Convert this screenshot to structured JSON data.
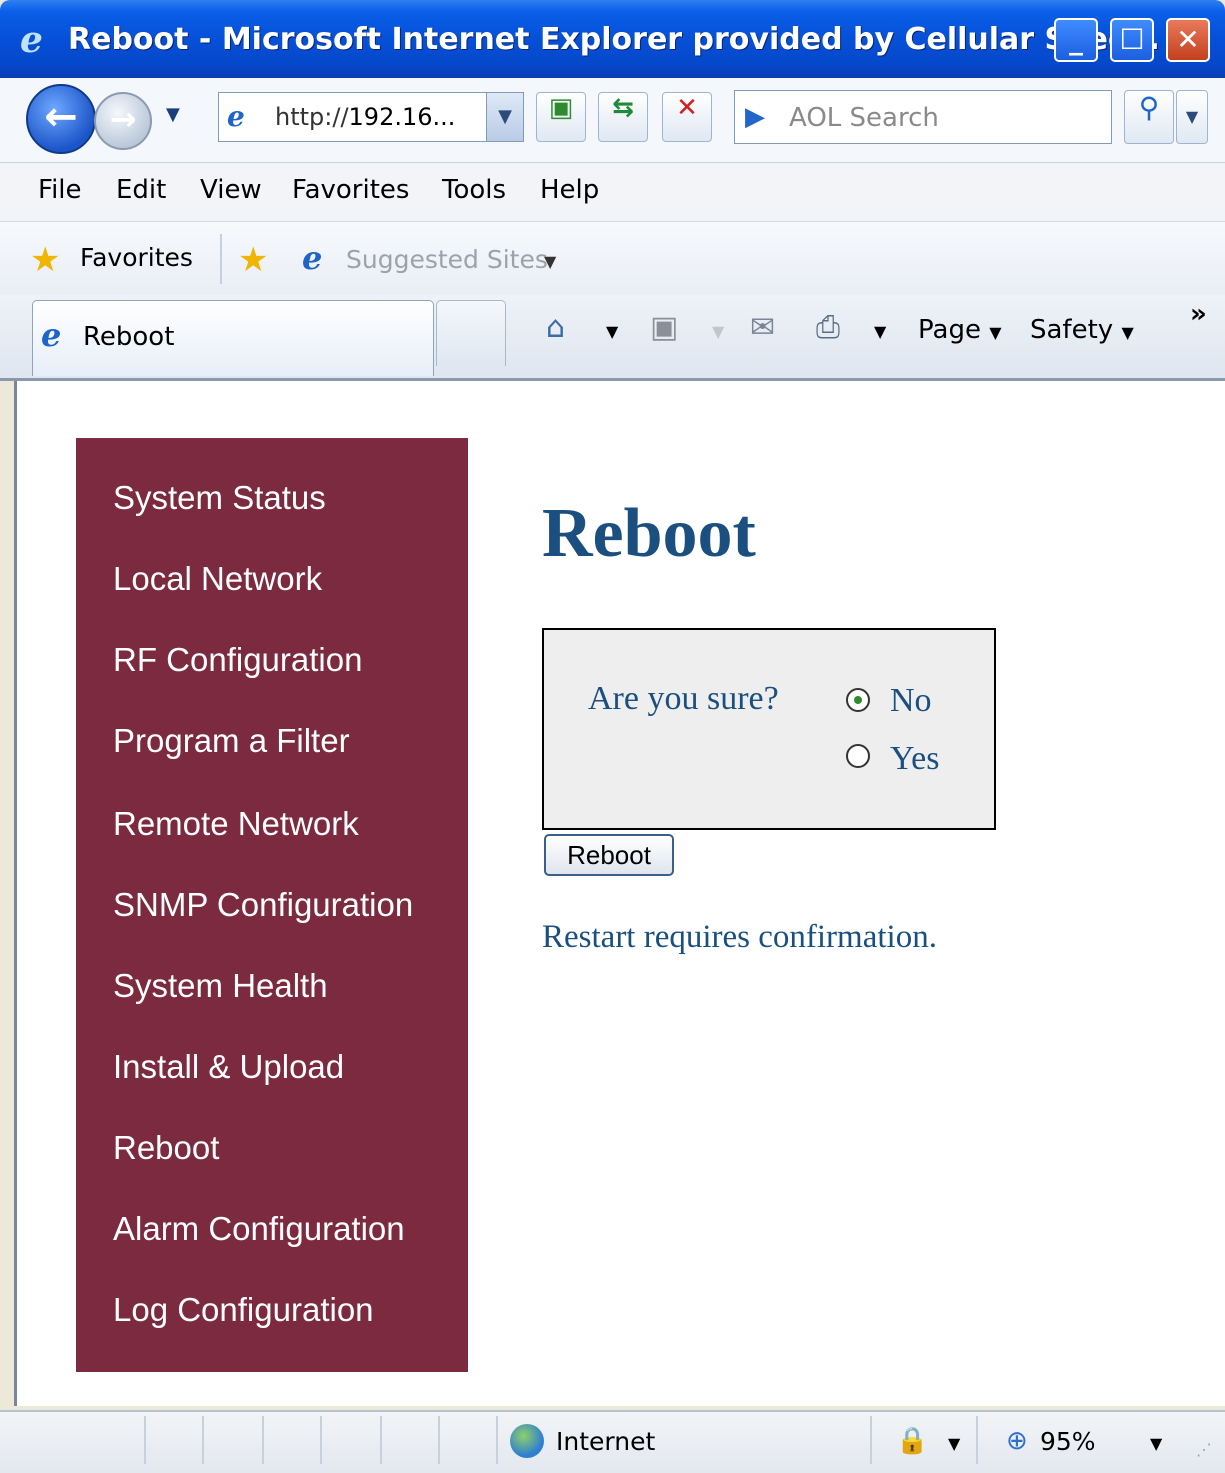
{
  "window": {
    "title": "Reboot - Microsoft Internet Explorer provided by Cellular Spec...",
    "minimize_label": "_",
    "maximize_label": "☐",
    "close_label": "✕"
  },
  "navbar": {
    "address_prefix": "http://",
    "address_host": "192.16...",
    "search_placeholder": "AOL Search"
  },
  "menu": {
    "items": [
      "File",
      "Edit",
      "View",
      "Favorites",
      "Tools",
      "Help"
    ]
  },
  "favorites_bar": {
    "favorites_label": "Favorites",
    "suggested_sites_label": "Suggested Sites"
  },
  "tabs": {
    "active_tab": "Reboot"
  },
  "command_bar": {
    "page_label": "Page",
    "safety_label": "Safety",
    "more_label": "»"
  },
  "sidebar": {
    "items": [
      "System Status",
      "Local Network",
      "RF Configuration",
      "Program a Filter",
      "Remote Network",
      "SNMP Configuration",
      "System Health",
      "Install & Upload",
      "Reboot",
      "Alarm Configuration",
      "Log Configuration"
    ]
  },
  "main": {
    "title": "Reboot",
    "question": "Are you sure?",
    "options": [
      {
        "label": "No",
        "checked": true
      },
      {
        "label": "Yes",
        "checked": false
      }
    ],
    "button_label": "Reboot",
    "note": "Restart requires confirmation."
  },
  "statusbar": {
    "zone": "Internet",
    "zoom": "95%"
  },
  "colors": {
    "sidebar_bg": "#7b2a3f",
    "heading": "#1a4f80",
    "titlebar": "#0650d8"
  },
  "icons": [
    "ie-logo-icon",
    "back-icon",
    "forward-icon",
    "compat-view-icon",
    "refresh-icon",
    "stop-icon",
    "search-icon",
    "star-icon",
    "add-favorite-icon",
    "home-icon",
    "feeds-icon",
    "mail-icon",
    "print-icon",
    "globe-icon",
    "zoom-icon"
  ]
}
